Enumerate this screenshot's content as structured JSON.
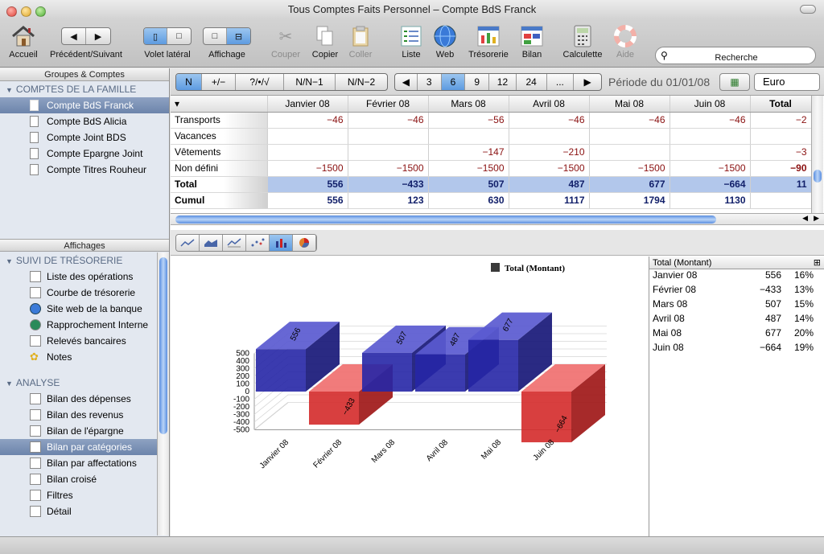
{
  "window": {
    "title": "Tous Comptes Faits Personnel – Compte BdS Franck"
  },
  "toolbar": {
    "accueil": "Accueil",
    "precedent_suivant": "Précédent/Suivant",
    "volet_lateral": "Volet latéral",
    "affichage": "Affichage",
    "couper": "Couper",
    "copier": "Copier",
    "coller": "Coller",
    "liste": "Liste",
    "web": "Web",
    "tresorerie": "Trésorerie",
    "bilan": "Bilan",
    "calculette": "Calculette",
    "aide": "Aide",
    "recherche": "Recherche",
    "search_value": ""
  },
  "sidebar": {
    "groups_header": "Groupes & Comptes",
    "family_section": "COMPTES DE LA FAMILLE",
    "accounts": [
      "Compte BdS Franck",
      "Compte BdS Alicia",
      "Compte Joint BDS",
      "Compte Epargne Joint",
      "Compte Titres Rouheur"
    ],
    "views_header": "Affichages",
    "tresorerie_section": "SUIVI DE TRÉSORERIE",
    "tresorerie_items": [
      "Liste des opérations",
      "Courbe de trésorerie",
      "Site web de la banque",
      "Rapprochement Interne",
      "Relevés bancaires",
      "Notes"
    ],
    "analyse_section": "ANALYSE",
    "analyse_items": [
      "Bilan des dépenses",
      "Bilan des revenus",
      "Bilan de l'épargne",
      "Bilan par catégories",
      "Bilan par affectations",
      "Bilan croisé",
      "Filtres",
      "Détail"
    ]
  },
  "controls": {
    "mode_segments": [
      "N",
      "+/−",
      "?/•/√",
      "N/N−1",
      "N/N−2"
    ],
    "period_segments": [
      "◀",
      "3",
      "6",
      "9",
      "12",
      "24",
      "...",
      "▶"
    ],
    "periode_label": "Période du 01/01/08",
    "currency": "Euro"
  },
  "table": {
    "columns": [
      "Janvier 08",
      "Février 08",
      "Mars 08",
      "Avril 08",
      "Mai 08",
      "Juin 08",
      "Total"
    ],
    "rows": [
      {
        "label": "Transports",
        "cells": [
          "−46",
          "−46",
          "−56",
          "−46",
          "−46",
          "−46",
          "−2"
        ]
      },
      {
        "label": "Vacances",
        "cells": [
          "",
          "",
          "",
          "",
          "",
          "",
          ""
        ]
      },
      {
        "label": "Vêtements",
        "cells": [
          "",
          "",
          "−147",
          "−210",
          "",
          "",
          "−3"
        ]
      },
      {
        "label": "Non défini",
        "cells": [
          "−1500",
          "−1500",
          "−1500",
          "−1500",
          "−1500",
          "−1500",
          "−90"
        ]
      },
      {
        "label": "Total",
        "cells": [
          "556",
          "−433",
          "507",
          "487",
          "677",
          "−664",
          "11"
        ]
      },
      {
        "label": "Cumul",
        "cells": [
          "556",
          "123",
          "630",
          "1117",
          "1794",
          "1130",
          ""
        ]
      }
    ]
  },
  "chart_tabs": [
    "line",
    "area",
    "line2",
    "scatter",
    "bar",
    "pie"
  ],
  "chart_data": {
    "type": "bar",
    "legend": "Total (Montant)",
    "categories": [
      "Janvier 08",
      "Février 08",
      "Mars 08",
      "Avril 08",
      "Mai 08",
      "Juin 08"
    ],
    "values": [
      556,
      -433,
      507,
      487,
      677,
      -664
    ],
    "yticks": [
      500,
      400,
      300,
      200,
      100,
      0,
      -100,
      -200,
      -300,
      -400,
      -500
    ],
    "ylim": [
      -500,
      500
    ],
    "colors": {
      "positive": "#2a2aa8",
      "negative": "#d42a2a"
    }
  },
  "legend_table": {
    "header": "Total (Montant)",
    "rows": [
      {
        "name": "Janvier 08",
        "value": "556",
        "pct": "16%"
      },
      {
        "name": "Février 08",
        "value": "−433",
        "pct": "13%"
      },
      {
        "name": "Mars 08",
        "value": "507",
        "pct": "15%"
      },
      {
        "name": "Avril 08",
        "value": "487",
        "pct": "14%"
      },
      {
        "name": "Mai 08",
        "value": "677",
        "pct": "20%"
      },
      {
        "name": "Juin 08",
        "value": "−664",
        "pct": "19%"
      }
    ]
  }
}
